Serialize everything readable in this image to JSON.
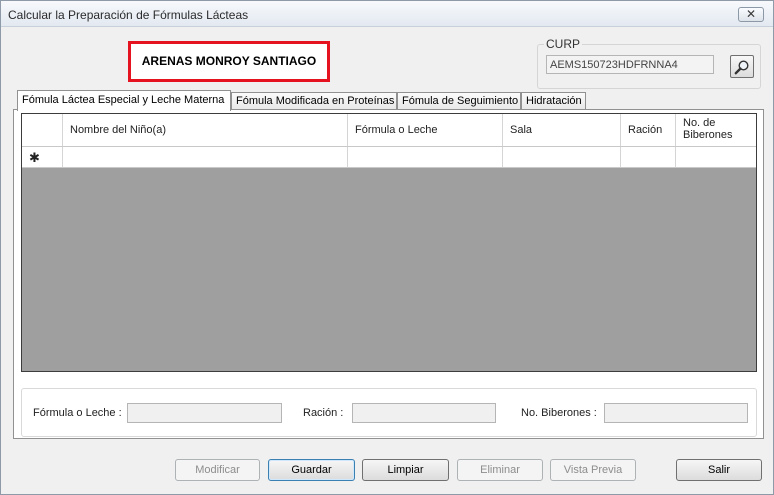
{
  "window": {
    "title": "Calcular la Preparación de Fórmulas Lácteas",
    "close_label": "✕"
  },
  "patient": {
    "name": "ARENAS MONROY SANTIAGO"
  },
  "curp": {
    "label": "CURP",
    "value": "AEMS150723HDFRNNA4"
  },
  "tabs": [
    {
      "label": "Fómula Láctea Especial y Leche Materna",
      "active": true
    },
    {
      "label": "Fómula Modificada en Proteínas",
      "active": false
    },
    {
      "label": "Fómula de Seguimiento",
      "active": false
    },
    {
      "label": "Hidratación",
      "active": false
    }
  ],
  "grid": {
    "columns": [
      "Nombre del Niño(a)",
      "Fórmula o Leche",
      "Sala",
      "Ración",
      "No. de Biberones"
    ],
    "new_row_marker": "✱"
  },
  "details": {
    "formula_label": "Fórmula o Leche :",
    "racion_label": "Ración :",
    "biberones_label": "No. Biberones :"
  },
  "buttons": {
    "modificar": "Modificar",
    "guardar": "Guardar",
    "limpiar": "Limpiar",
    "eliminar": "Eliminar",
    "vista_previa": "Vista Previa",
    "salir": "Salir"
  },
  "icons": {
    "search": "magnifier-icon"
  }
}
